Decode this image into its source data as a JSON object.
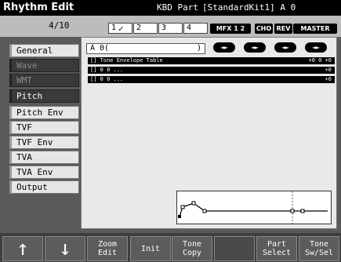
{
  "header": {
    "title": "Rhythm Edit",
    "part": "KBD Part",
    "kit": "[StandardKit1] A 0"
  },
  "parts": {
    "p1": "1",
    "p2": "2",
    "p3": "3",
    "p4": "4",
    "p1_checked": "✓"
  },
  "fx": {
    "mfx": "MFX",
    "mfx1": "1",
    "mfx2": "2",
    "cho": "CHO",
    "rev": "REV",
    "master": "MASTER"
  },
  "page": "4/10",
  "tabs": [
    {
      "label": "General"
    },
    {
      "label": "Wave"
    },
    {
      "label": "WMT"
    },
    {
      "label": "Pitch"
    },
    {
      "label": "Pitch Env"
    },
    {
      "label": "TVF"
    },
    {
      "label": "TVF Env"
    },
    {
      "label": "TVA"
    },
    {
      "label": "TVA Env"
    },
    {
      "label": "Output"
    }
  ],
  "panel": {
    "wave_select": "A 0(",
    "wave_bracket": ")",
    "pills": [
      "◄►",
      "◄►",
      "◄►",
      "◄►"
    ],
    "rows": [
      {
        "text": "[] Tone Envelope Table",
        "value": "+0 0 +0"
      },
      {
        "text": "[] 0 0 ...",
        "value": "+0"
      },
      {
        "text": "[] 0 0 ...",
        "value": "+0"
      }
    ]
  },
  "footer": {
    "up": "↑",
    "down": "↓",
    "zoom1": "Zoom",
    "zoom2": "Edit",
    "init": "Init",
    "tone1": "Tone",
    "tone2": "Copy",
    "part1": "Part",
    "part2": "Select",
    "sw1": "Tone",
    "sw2": "Sw/Sel"
  },
  "colors": {
    "accent": "#000000",
    "panel": "#e9e9e9",
    "tab_active": "#3a3a3a"
  }
}
